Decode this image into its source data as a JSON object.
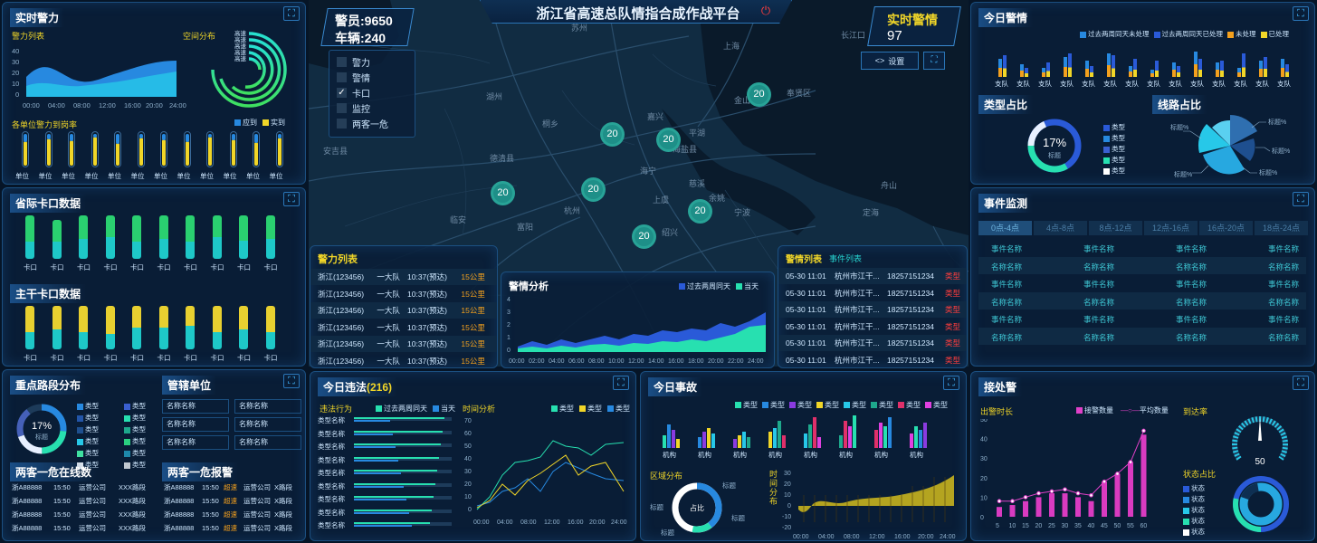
{
  "header": {
    "title": "浙江省高速总队情指合成作战平台",
    "police_label": "警员:9650",
    "vehicle_label": "车辆:240",
    "alert_label": "实时警情",
    "alert_value": "97",
    "settings_label": "设置"
  },
  "map_layers": [
    {
      "label": "警力",
      "checked": false
    },
    {
      "label": "警情",
      "checked": false
    },
    {
      "label": "卡口",
      "checked": true
    },
    {
      "label": "监控",
      "checked": false
    },
    {
      "label": "两客一危",
      "checked": false
    }
  ],
  "clusters": [
    "20",
    "20",
    "20",
    "20",
    "20",
    "20",
    "20"
  ],
  "map_labels": [
    "苏州",
    "上海",
    "长江口",
    "湖州",
    "嘉兴",
    "杭州",
    "宁波",
    "绍兴",
    "安吉县",
    "海宁",
    "慈溪",
    "余姚",
    "上虞",
    "舟山",
    "定海",
    "桐乡",
    "德清县",
    "海盐县",
    "富阳",
    "临安",
    "平湖",
    "金山区",
    "奉贤区"
  ],
  "police_force": {
    "title": "实时警力",
    "list_label": "警力列表",
    "space_label": "空间分布",
    "x_labels": [
      "00:00",
      "04:00",
      "08:00",
      "12:00",
      "16:00",
      "20:00",
      "24:00"
    ],
    "y_labels": [
      "40",
      "30",
      "20",
      "10",
      "0"
    ],
    "ring_labels": [
      "高速",
      "高速",
      "高速",
      "高速",
      "高速"
    ],
    "rate_title": "各单位警力到岗率",
    "legend": [
      "应到",
      "实到"
    ],
    "units": [
      "单位",
      "单位",
      "单位",
      "单位",
      "单位",
      "单位",
      "单位",
      "单位",
      "单位",
      "单位",
      "单位",
      "单位"
    ],
    "rates": [
      0.75,
      0.82,
      0.78,
      0.9,
      0.7,
      0.85,
      0.8,
      0.75,
      0.88,
      0.8,
      0.72,
      0.86
    ]
  },
  "provincial": {
    "title": "省际卡口数据",
    "label": "卡口",
    "values": [
      [
        0.6,
        0.4
      ],
      [
        0.5,
        0.4
      ],
      [
        0.55,
        0.45
      ],
      [
        0.5,
        0.5
      ],
      [
        0.6,
        0.4
      ],
      [
        0.55,
        0.45
      ],
      [
        0.6,
        0.4
      ],
      [
        0.5,
        0.5
      ],
      [
        0.58,
        0.42
      ],
      [
        0.55,
        0.45
      ]
    ]
  },
  "trunk": {
    "title": "主干卡口数据",
    "label": "卡口",
    "values": [
      [
        0.6,
        0.4
      ],
      [
        0.55,
        0.45
      ],
      [
        0.6,
        0.4
      ],
      [
        0.65,
        0.35
      ],
      [
        0.5,
        0.5
      ],
      [
        0.5,
        0.5
      ],
      [
        0.45,
        0.55
      ],
      [
        0.6,
        0.4
      ],
      [
        0.55,
        0.45
      ],
      [
        0.6,
        0.4
      ]
    ]
  },
  "key_roads": {
    "title": "重点路段分布",
    "pct": "17%",
    "center": "标题",
    "legend": [
      "类型",
      "类型",
      "类型",
      "类型",
      "类型",
      "类型",
      "类型",
      "类型",
      "类型",
      "类型",
      "类型",
      "类型"
    ]
  },
  "jurisdiction": {
    "title": "管辖单位",
    "items": [
      "名称名称",
      "名称名称",
      "名称名称",
      "名称名称",
      "名称名称",
      "名称名称"
    ]
  },
  "online": {
    "title": "两客一危在线数",
    "rows": [
      [
        "浙A88888",
        "15:50",
        "运营公司",
        "XXX路段"
      ],
      [
        "浙A88888",
        "15:50",
        "运营公司",
        "XXX路段"
      ],
      [
        "浙A88888",
        "15:50",
        "运营公司",
        "XXX路段"
      ],
      [
        "浙A88888",
        "15:50",
        "运营公司",
        "XXX路段"
      ]
    ]
  },
  "alarm": {
    "title": "两客一危报警",
    "rows": [
      [
        "浙A88888",
        "15:50",
        "超速",
        "运营公司",
        "X路段"
      ],
      [
        "浙A88888",
        "15:50",
        "超速",
        "运营公司",
        "X路段"
      ],
      [
        "浙A88888",
        "15:50",
        "超速",
        "运营公司",
        "X路段"
      ],
      [
        "浙A88888",
        "15:50",
        "超速",
        "运营公司",
        "X路段"
      ]
    ]
  },
  "force_list": {
    "title": "警力列表",
    "rows": [
      [
        "浙江(123456)",
        "一大队",
        "10:37(预达)",
        "15公里"
      ],
      [
        "浙江(123456)",
        "一大队",
        "10:37(预达)",
        "15公里"
      ],
      [
        "浙江(123456)",
        "一大队",
        "10:37(预达)",
        "15公里"
      ],
      [
        "浙江(123456)",
        "一大队",
        "10:37(预达)",
        "15公里"
      ],
      [
        "浙江(123456)",
        "一大队",
        "10:37(预达)",
        "15公里"
      ],
      [
        "浙江(123456)",
        "一大队",
        "10:37(预达)",
        "15公里"
      ]
    ]
  },
  "analysis": {
    "title": "警情分析",
    "legend": [
      "过去两周同天",
      "当天"
    ],
    "x_labels": [
      "00:00",
      "02:00",
      "04:00",
      "06:00",
      "08:00",
      "10:00",
      "12:00",
      "14:00",
      "16:00",
      "18:00",
      "20:00",
      "22:00",
      "24:00"
    ],
    "y_labels": [
      "4",
      "3",
      "2",
      "1",
      "0"
    ]
  },
  "alert_list": {
    "title": "警情列表",
    "tab": "事件列表",
    "rows": [
      [
        "05-30 11:01",
        "杭州市江干...",
        "18257151234",
        "类型"
      ],
      [
        "05-30 11:01",
        "杭州市江干...",
        "18257151234",
        "类型"
      ],
      [
        "05-30 11:01",
        "杭州市江干...",
        "18257151234",
        "类型"
      ],
      [
        "05-30 11:01",
        "杭州市江干...",
        "18257151234",
        "类型"
      ],
      [
        "05-30 11:01",
        "杭州市江干...",
        "18257151234",
        "类型"
      ],
      [
        "05-30 11:01",
        "杭州市江干...",
        "18257151234",
        "类型"
      ]
    ]
  },
  "today_alerts": {
    "title": "今日警情",
    "legend": [
      "过去两周同天未处理",
      "过去两周同天已处理",
      "未处理",
      "已处理"
    ],
    "labels": [
      "支队",
      "支队",
      "支队",
      "支队",
      "支队",
      "支队",
      "支队",
      "支队",
      "支队",
      "支队",
      "支队",
      "支队",
      "支队",
      "支队"
    ],
    "type_title": "类型占比",
    "type_pct": "17%",
    "type_center": "标题",
    "type_legend": [
      "类型",
      "类型",
      "类型",
      "类型",
      "类型"
    ],
    "route_title": "线路占比",
    "route_labels": [
      "标题%",
      "标题%",
      "标题%",
      "标题%",
      "标题%"
    ]
  },
  "events": {
    "title": "事件监测",
    "tabs": [
      "0点-4点",
      "4点-8点",
      "8点-12点",
      "12点-16点",
      "16点-20点",
      "18点-24点"
    ],
    "rows": [
      [
        "事件名称",
        "事件名称",
        "事件名称",
        "事件名称"
      ],
      [
        "名称名称",
        "名称名称",
        "名称名称",
        "名称名称"
      ],
      [
        "事件名称",
        "事件名称",
        "事件名称",
        "事件名称"
      ],
      [
        "名称名称",
        "名称名称",
        "名称名称",
        "名称名称"
      ],
      [
        "事件名称",
        "事件名称",
        "事件名称",
        "事件名称"
      ],
      [
        "名称名称",
        "名称名称",
        "名称名称",
        "名称名称"
      ]
    ]
  },
  "violations": {
    "title": "今日违法",
    "count": "(216)",
    "behavior_label": "违法行为",
    "legend": [
      "过去两周同天",
      "当天"
    ],
    "rows": [
      "类型名称",
      "类型名称",
      "类型名称",
      "类型名称",
      "类型名称",
      "类型名称",
      "类型名称",
      "类型名称",
      "类型名称"
    ],
    "time_label": "时间分析",
    "time_legend": [
      "类型",
      "类型",
      "类型"
    ],
    "x_labels": [
      "00:00",
      "04:00",
      "08:00",
      "12:00",
      "16:00",
      "20:00",
      "24:00"
    ],
    "y_labels": [
      "70",
      "60",
      "50",
      "40",
      "30",
      "20",
      "10",
      "0"
    ]
  },
  "accidents": {
    "title": "今日事故",
    "legend": [
      "类型",
      "类型",
      "类型",
      "类型",
      "类型",
      "类型",
      "类型",
      "类型"
    ],
    "labels": [
      "机构",
      "机构",
      "机构",
      "机构",
      "机构",
      "机构",
      "机构",
      "机构"
    ],
    "region_label": "区域分布",
    "donut_center": "占比",
    "donut_labels": [
      "标题",
      "标题",
      "标题",
      "标题"
    ],
    "time_label": "时间分布",
    "x_labels": [
      "00:00",
      "04:00",
      "08:00",
      "12:00",
      "16:00",
      "20:00",
      "24:00"
    ],
    "y_labels": [
      "30",
      "20",
      "10",
      "0",
      "-10",
      "-20"
    ]
  },
  "dispatch": {
    "title": "接处警",
    "duration_label": "出警时长",
    "legend": [
      "接警数量",
      "平均数量"
    ],
    "arrival_label": "到达率",
    "gauge_value": "50",
    "status_label": "状态占比",
    "status_legend": [
      "状态",
      "状态",
      "状态",
      "状态",
      "状态"
    ],
    "x_labels": [
      "5",
      "10",
      "15",
      "20",
      "25",
      "30",
      "35",
      "40",
      "45",
      "50",
      "55",
      "60"
    ],
    "y_labels": [
      "50",
      "40",
      "30",
      "20",
      "10",
      "0"
    ],
    "values": [
      5,
      6,
      8,
      10,
      12,
      12,
      10,
      8,
      18,
      22,
      28,
      42
    ],
    "avg": [
      8,
      8,
      10,
      12,
      13,
      14,
      12,
      11,
      18,
      22,
      28,
      44
    ]
  }
}
